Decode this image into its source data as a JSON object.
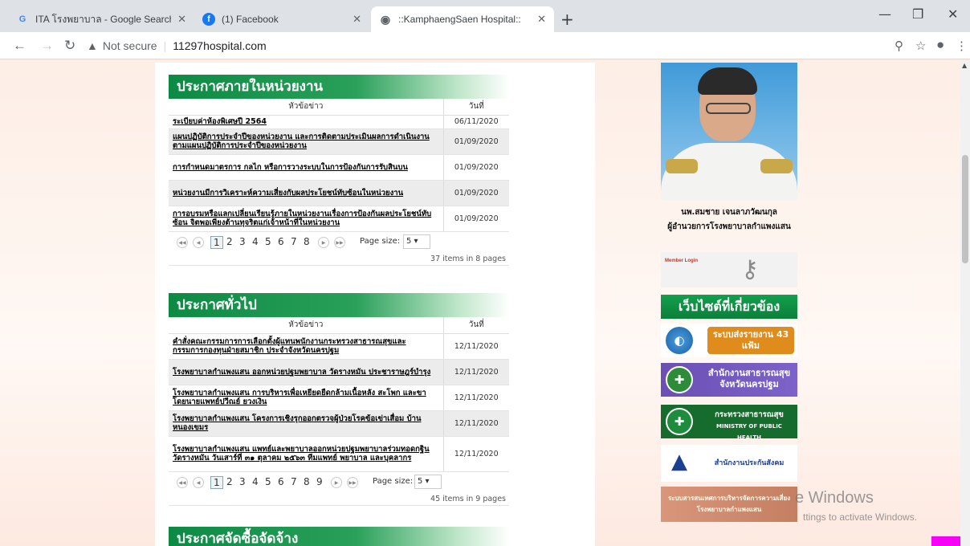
{
  "browser": {
    "tabs": [
      {
        "favicon": "G",
        "title": "ITA โรงพยาบาล - Google Search"
      },
      {
        "favicon": "f",
        "title": "(1) Facebook"
      },
      {
        "favicon": "globe",
        "title": "::KamphaengSaen Hospital::"
      }
    ],
    "url": "11297hospital.com",
    "security": "Not secure"
  },
  "section1": {
    "title": "ประกาศภายในหน่วยงาน",
    "col_title": "หัวข้อข่าว",
    "col_date": "วันที่",
    "rows": [
      {
        "title": "ระเบียบค่าห้องพิเศษปี 2564",
        "date": "06/11/2020"
      },
      {
        "title": "แผนปฏิบัติการประจำปีของหน่วยงาน และการติดตามประเมินผลการดำเนินงานตามแผนปฏิบัติการประจำปีของหน่วยงาน",
        "date": "01/09/2020"
      },
      {
        "title": "การกำหนดมาตรการ กลไก หรือการวางระบบในการป้องกันการรับสินบน",
        "date": "01/09/2020"
      },
      {
        "title": "หน่วยงานมีการวิเคราะห์ความเสี่ยงกับผลประโยชน์ทับซ้อนในหน่วยงาน",
        "date": "01/09/2020"
      },
      {
        "title": "การอบรมหรือแลกเปลี่ยนเรียนรู้ภายในหน่วยงานเรื่องการป้องกันผลประโยชน์ทับซ้อน จิตพอเพียงต้านทุจริตแก่เจ้าหน้าที่ในหน่วยงาน",
        "date": "01/09/2020"
      }
    ],
    "pages": [
      "1",
      "2",
      "3",
      "4",
      "5",
      "6",
      "7",
      "8"
    ],
    "page_size_label": "Page size:",
    "page_size": "5",
    "summary": "37 items in 8 pages"
  },
  "section2": {
    "title": "ประกาศทั่วไป",
    "col_title": "หัวข้อข่าว",
    "col_date": "วันที่",
    "rows": [
      {
        "title": "คำสั่งคณะกรรมการการเลือกตั้งผู้แทนพนักงานกระทรวงสาธารณสุขและกรรมการกองทุนฝ่ายสมาชิก ประจำจังหวัดนครปฐม",
        "date": "12/11/2020"
      },
      {
        "title": "โรงพยาบาลกำแพงแสน ออกหน่วยปฐมพยาบาล วัดรางหมัน ประชาราษฎร์บำรุง",
        "date": "12/11/2020"
      },
      {
        "title": "โรงพยาบาลกำแพงแสน การบริหารเพื่อเหยียดยืดกล้ามเนื้อหลัง สะโพก และขา โดยนายแพทย์ปวีณย์ ยวงเงิน",
        "date": "12/11/2020"
      },
      {
        "title": "โรงพยาบาลกำแพงแสน โครงการเชิงรุกออกตรวจผู้ป่วยโรคข้อเข่าเสื่อม บ้านหนองเขมร",
        "date": "12/11/2020"
      },
      {
        "title": "โรงพยาบาลกำแพงแสน แพทย์และพยาบาลออกหน่วยปฐมพยาบาลร่วมทอดกฐินวัดรางหมัน วันเสาร์ที่ ๓๑ ตุลาคม ๒๕๖๓ ทีมแพทย์ พยาบาล และบุคลากร",
        "date": "12/11/2020"
      }
    ],
    "pages": [
      "1",
      "2",
      "3",
      "4",
      "5",
      "6",
      "7",
      "8",
      "9"
    ],
    "page_size_label": "Page size:",
    "page_size": "5",
    "summary": "45 items in 9 pages"
  },
  "section3": {
    "title": "ประกาศจัดซื้อจัดจ้าง"
  },
  "sidebar": {
    "director_name": "นพ.สมชาย เจนลาภวัฒนกุล",
    "director_title": "ผู้อำนวยการโรงพยาบาลกำแพงแสน",
    "member_login": "Member Login",
    "related_title": "เว็บไซต์ที่เกี่ยวข้อง",
    "banner1": "ระบบส่งรายงาน 43 แฟ้ม",
    "banner2": "สำนักงานสาธารณสุข จังหวัดนครปฐม",
    "banner3": "กระทรวงสาธารณสุข",
    "banner3_sub": "MINISTRY OF PUBLIC HEALTH",
    "banner4": "สำนักงานประกันสังคม",
    "banner5": "ระบบสารสนเทศการบริหารจัดการความเสี่ยง โรงพยาบาลกำแพงแสน"
  },
  "watermark": {
    "line1": "e Windows",
    "line2": "ttings to activate Windows."
  },
  "colors": {
    "section_green": "#0c8a44",
    "page_bg": "#fbe9df",
    "accent_pink": "#f700f7"
  }
}
